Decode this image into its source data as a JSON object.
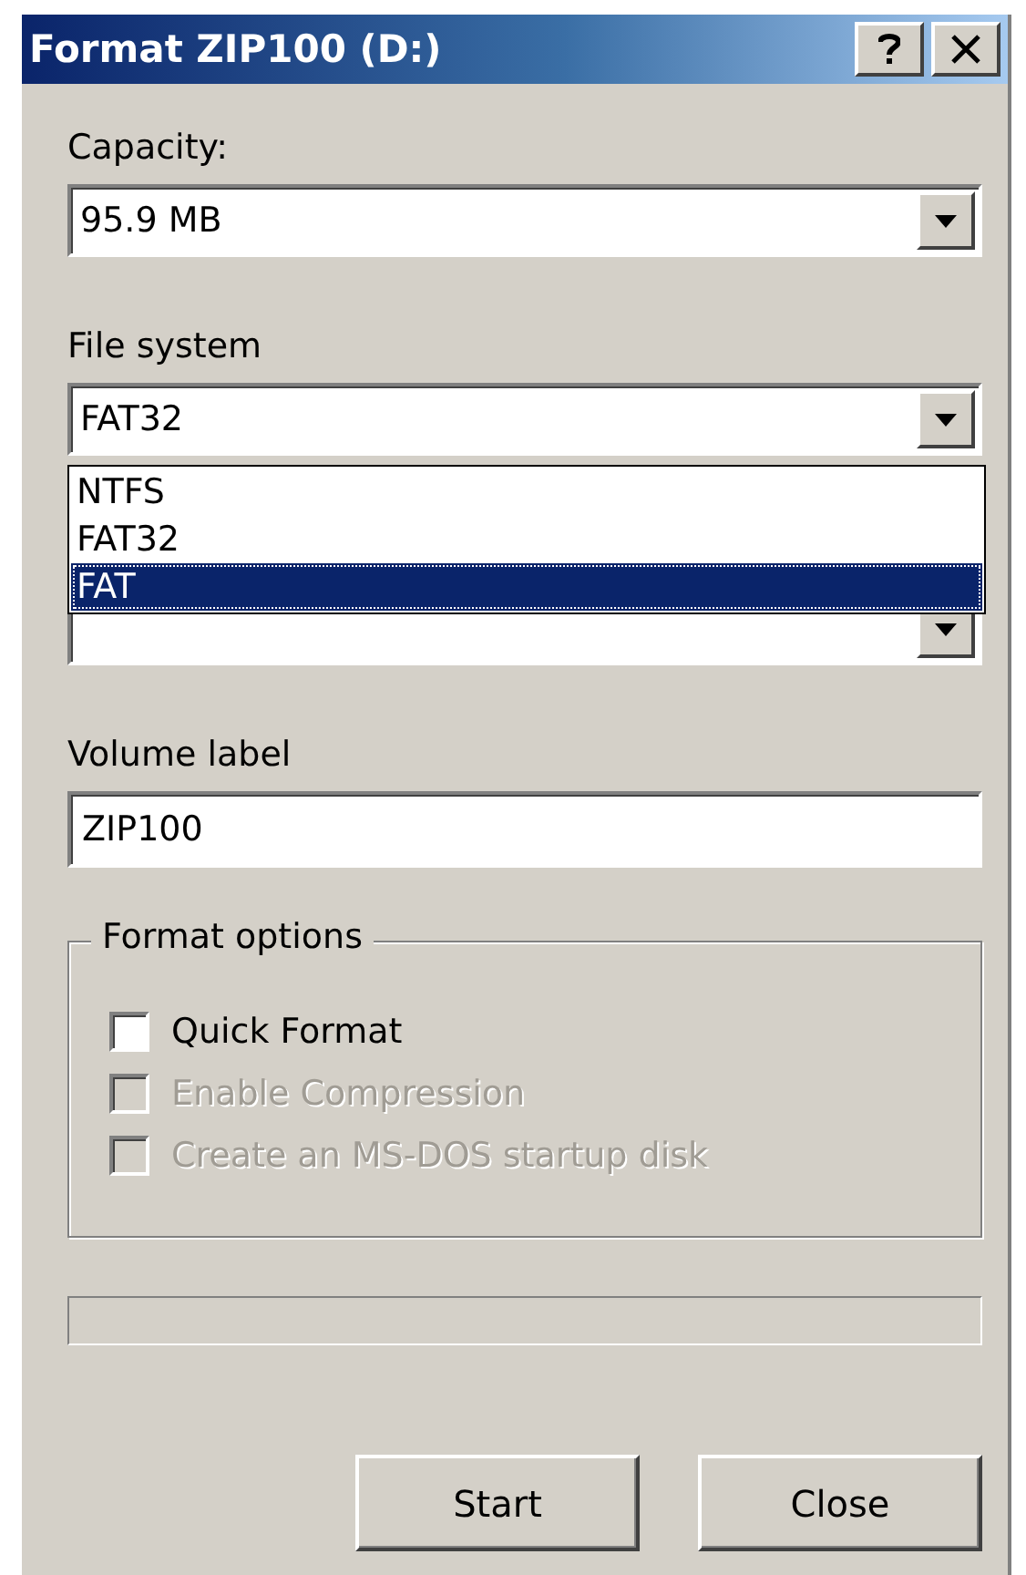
{
  "window": {
    "title": "Format ZIP100 (D:)"
  },
  "capacity": {
    "label": "Capacity:",
    "value": "95.9 MB"
  },
  "file_system": {
    "label": "File system",
    "value": "FAT32",
    "expanded": true,
    "options": [
      {
        "label": "NTFS",
        "highlighted": false
      },
      {
        "label": "FAT32",
        "highlighted": false
      },
      {
        "label": "FAT",
        "highlighted": true
      }
    ]
  },
  "volume_label": {
    "label": "Volume label",
    "value": "ZIP100"
  },
  "format_options": {
    "title": "Format options",
    "options": [
      {
        "label": "Quick Format",
        "checked": false,
        "disabled": false
      },
      {
        "label": "Enable Compression",
        "checked": false,
        "disabled": true
      },
      {
        "label": "Create an MS-DOS startup disk",
        "checked": false,
        "disabled": true
      }
    ]
  },
  "progress": {
    "level": 0
  },
  "buttons": [
    {
      "label": "Start"
    },
    {
      "label": "Close"
    }
  ]
}
